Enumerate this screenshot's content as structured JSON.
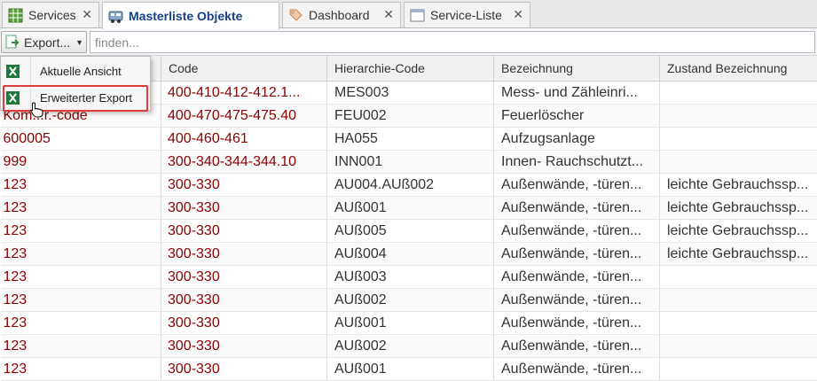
{
  "tabs": [
    {
      "label": "Services",
      "icon": "grid-icon",
      "active": false
    },
    {
      "label": "Masterliste Objekte",
      "icon": "vehicle-icon",
      "active": true
    },
    {
      "label": "Dashboard",
      "icon": "tag-icon",
      "active": false
    },
    {
      "label": "Service-Liste",
      "icon": "window-icon",
      "active": false
    }
  ],
  "toolbar": {
    "export_label": "Export...",
    "search_placeholder": "finden..."
  },
  "menu": {
    "items": [
      {
        "label": "Aktuelle Ansicht",
        "icon": "excel-icon"
      },
      {
        "label": "Erweiterter Export",
        "icon": "excel-icon"
      }
    ]
  },
  "grid": {
    "columns": [
      "",
      "Code",
      "Hierarchie-Code",
      "Bezeichnung",
      "Zustand Bezeichnung"
    ],
    "rows": [
      [
        "",
        "400-410-412-412.1...",
        "MES003",
        "Mess- und Zähleinri...",
        ""
      ],
      [
        "Kom...r.-code",
        "400-470-475-475.40",
        "FEU002",
        "Feuerlöscher",
        ""
      ],
      [
        "600005",
        "400-460-461",
        "HA055",
        "Aufzugsanlage",
        ""
      ],
      [
        "999",
        "300-340-344-344.10",
        "INN001",
        "Innen- Rauchschutzt...",
        ""
      ],
      [
        "123",
        "300-330",
        "AU004.AUß002",
        "Außenwände, -türen...",
        "leichte Gebrauchssp..."
      ],
      [
        "123",
        "300-330",
        "AUß001",
        "Außenwände, -türen...",
        "leichte Gebrauchssp..."
      ],
      [
        "123",
        "300-330",
        "AUß005",
        "Außenwände, -türen...",
        "leichte Gebrauchssp..."
      ],
      [
        "123",
        "300-330",
        "AUß004",
        "Außenwände, -türen...",
        "leichte Gebrauchssp..."
      ],
      [
        "123",
        "300-330",
        "AUß003",
        "Außenwände, -türen...",
        ""
      ],
      [
        "123",
        "300-330",
        "AUß002",
        "Außenwände, -türen...",
        ""
      ],
      [
        "123",
        "300-330",
        "AUß001",
        "Außenwände, -türen...",
        ""
      ],
      [
        "123",
        "300-330",
        "AUß002",
        "Außenwände, -türen...",
        ""
      ],
      [
        "123",
        "300-330",
        "AUß001",
        "Außenwände, -türen...",
        ""
      ]
    ]
  },
  "colors": {
    "accent_red": "#8b0000",
    "highlight_border": "#e23b3b",
    "active_tab_text": "#15428b"
  }
}
